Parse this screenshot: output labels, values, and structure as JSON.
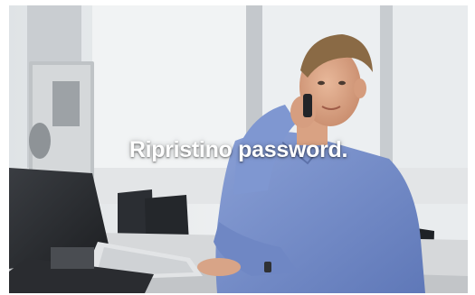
{
  "hero": {
    "title": "Ripristino password.",
    "image_description_icon": "office-worker-phone-photo"
  },
  "colors": {
    "title_text": "#ffffff",
    "shirt": "#7b93cf",
    "wall": "#e6e9ec",
    "desk": "#d6d8da",
    "chair": "#2b2e33"
  }
}
